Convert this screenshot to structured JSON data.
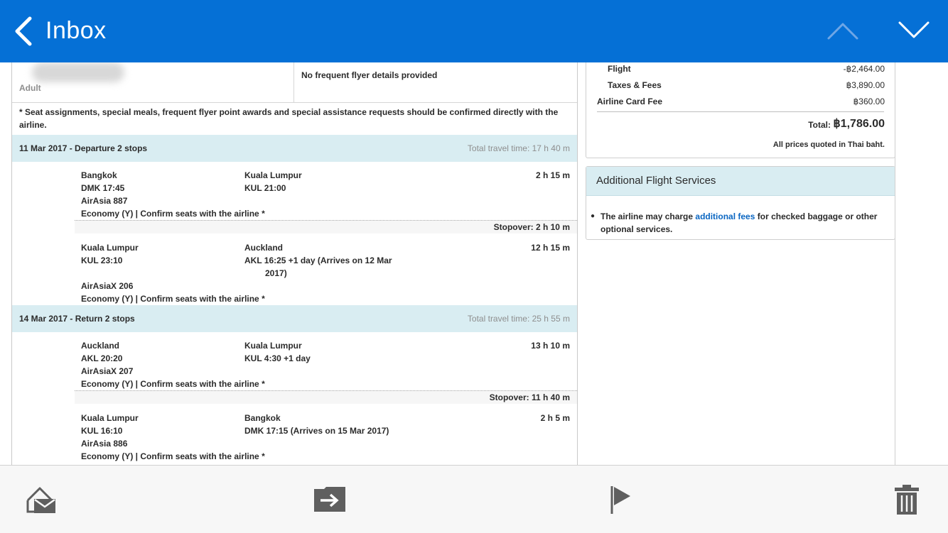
{
  "header": {
    "back_label": "Inbox"
  },
  "passenger": {
    "type_label": "Adult",
    "frequent_flyer": "No frequent flyer details provided",
    "note_line1": "* Seat assignments, special meals, frequent flyer point awards and special assistance requests should be confirmed directly with the",
    "note_line2": "airline."
  },
  "departure": {
    "header": "11 Mar 2017 - Departure 2 stops",
    "total_time": "Total travel time: 17 h 40 m",
    "leg1": {
      "from_city": "Bangkok",
      "from_code_time": "DMK  17:45",
      "airline": "AirAsia  887",
      "to_city": "Kuala Lumpur",
      "to_code_time": "KUL  21:00",
      "duration": "2 h 15 m",
      "cabin": "Economy (Y) | Confirm seats with the airline *"
    },
    "stopover": "Stopover: 2 h 10 m",
    "leg2": {
      "from_city": "Kuala Lumpur",
      "from_code_time": "KUL  23:10",
      "airline": "AirAsiaX  206",
      "to_city": "Auckland",
      "to_code_time_line1": "AKL  16:25 +1 day   (Arrives on 12 Mar",
      "to_code_time_line2": "2017)",
      "duration": "12 h 15 m",
      "cabin": "Economy (Y) | Confirm seats with the airline *"
    }
  },
  "return": {
    "header": "14 Mar 2017 - Return 2 stops",
    "total_time": "Total travel time: 25 h 55 m",
    "leg1": {
      "from_city": "Auckland",
      "from_code_time": "AKL  20:20",
      "airline": "AirAsiaX  207",
      "to_city": "Kuala Lumpur",
      "to_code_time": "KUL  4:30 +1 day",
      "duration": "13 h 10 m",
      "cabin": "Economy (Y) | Confirm seats with the airline *"
    },
    "stopover": "Stopover: 11 h 40 m",
    "leg2": {
      "from_city": "Kuala Lumpur",
      "from_code_time": "KUL  16:10",
      "airline": "AirAsia  886",
      "to_city": "Bangkok",
      "to_code_time": "DMK  17:15   (Arrives on 15 Mar 2017)",
      "duration": "2 h 5 m",
      "cabin": "Economy (Y) | Confirm seats with the airline *"
    }
  },
  "pricing": {
    "flight_label": "Flight",
    "flight_value": "-฿2,464.00",
    "taxes_label": "Taxes & Fees",
    "taxes_value": "฿3,890.00",
    "card_fee_label": "Airline Card Fee",
    "card_fee_value": "฿360.00",
    "total_label": "Total:",
    "total_value": "฿1,786.00",
    "note": "All prices quoted in Thai baht."
  },
  "additional_services": {
    "title": "Additional Flight Services",
    "text_before": "The airline may charge ",
    "link": "additional fees",
    "text_after": " for checked baggage or other",
    "text_line2": "optional services."
  },
  "toolbar": {
    "icons": [
      "mark-unread-icon",
      "move-folder-icon",
      "flag-icon",
      "trash-icon"
    ]
  },
  "colors": {
    "header_bg": "#0570d6",
    "section_bg": "#d9edf2",
    "link": "#0a66c2"
  }
}
